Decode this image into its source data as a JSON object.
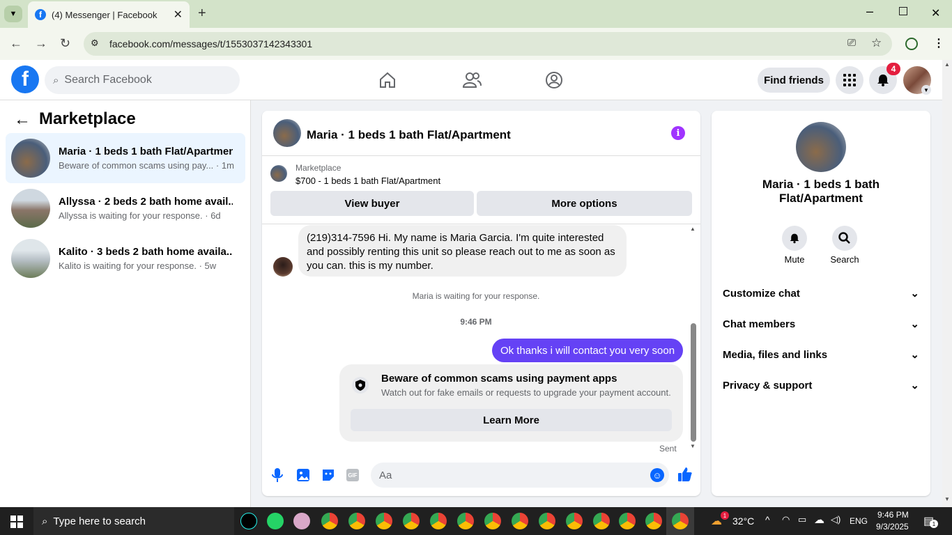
{
  "browser": {
    "tab_title": "(4) Messenger | Facebook",
    "url": "facebook.com/messages/t/1553037142343301"
  },
  "fb": {
    "search_placeholder": "Search Facebook",
    "find_friends": "Find friends",
    "notif_count": "4"
  },
  "sidebar": {
    "title": "Marketplace",
    "conversations": [
      {
        "name": "Maria · 1 beds 1 bath Flat/Apartment",
        "sub": "Beware of common scams using pay... · 1m"
      },
      {
        "name": "Allyssa · 2 beds 2 bath home avail...",
        "sub": "Allyssa is waiting for your response. · 6d"
      },
      {
        "name": "Kalito · 3 beds 2 bath home availa...",
        "sub": "Kalito is waiting for your response. · 5w"
      }
    ]
  },
  "chat": {
    "title": "Maria · 1 beds 1 bath Flat/Apartment",
    "listing_label": "Marketplace",
    "listing_price": "$700 - 1 beds 1 bath Flat/Apartment",
    "view_buyer": "View buyer",
    "more_options": "More options",
    "incoming_message": "(219)314-7596 Hi. My name is Maria Garcia. I'm quite interested and possibly renting this unit so please reach out to me as soon as you can. this is my number.",
    "waiting_note": "Maria is waiting for your response.",
    "timestamp": "9:46 PM",
    "outgoing_message": "Ok thanks i will contact you very soon",
    "scam_title": "Beware of common scams using payment apps",
    "scam_body": "Watch out for fake emails or requests to upgrade your payment account.",
    "learn_more": "Learn More",
    "sent_status": "Sent",
    "composer_placeholder": "Aa",
    "gif_label": "GIF"
  },
  "info": {
    "title": "Maria · 1 beds 1 bath Flat/Apartment",
    "mute": "Mute",
    "search": "Search",
    "sections": [
      "Customize chat",
      "Chat members",
      "Media, files and links",
      "Privacy & support"
    ]
  },
  "taskbar": {
    "search_placeholder": "Type here to search",
    "weather": "32°C",
    "lang": "ENG",
    "time": "9:46 PM",
    "date": "9/3/2025",
    "weather_badge": "1",
    "notif_badge": "1"
  },
  "colors": {
    "accent": "#1877f2",
    "outgoing_bubble": "#6542f5",
    "purple_icon": "#a033ff"
  }
}
